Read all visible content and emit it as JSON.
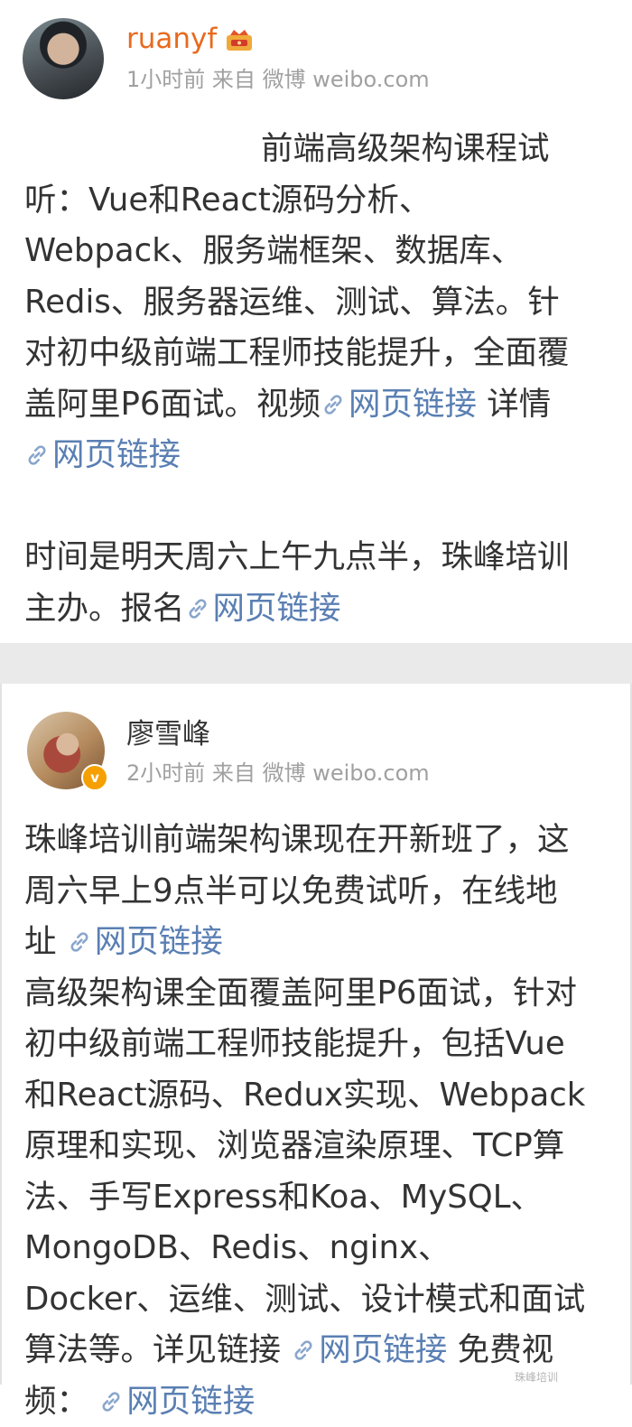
{
  "posts": [
    {
      "author": "ruanyf",
      "time": "1小时前",
      "source_prefix": "来自",
      "source": "微博 weibo.com",
      "badge_icon": "crown-member-icon",
      "body": {
        "l1": "前端高级架构课程试",
        "l2": "听：Vue和React源码分析、",
        "l3": "Webpack、服务端框架、数据库、",
        "l4": "Redis、服务器运维、测试、算法。针",
        "l5": "对初中级前端工程师技能提升，全面覆",
        "l6a": "盖阿里P6面试。视频",
        "link1": "网页链接",
        "l6b": " 详情",
        "link2": "网页链接",
        "l9": "时间是明天周六上午九点半，珠峰培训",
        "l10a": "主办。报名",
        "link3": "网页链接"
      }
    },
    {
      "author": "廖雪峰",
      "time": "2小时前",
      "source_prefix": "来自",
      "source": "微博 weibo.com",
      "verified_mark": "v",
      "body": {
        "l1": "珠峰培训前端架构课现在开新班了，这",
        "l2": "周六早上9点半可以免费试听，在线地",
        "l3a": "址 ",
        "link1": "网页链接",
        "l4": "高级架构课全面覆盖阿里P6面试，针对",
        "l5": "初中级前端工程师技能提升，包括Vue",
        "l6": "和React源码、Redux实现、Webpack",
        "l7": "原理和实现、浏览器渲染原理、TCP算",
        "l8": "法、手写Express和Koa、MySQL、",
        "l9": "MongoDB、Redis、nginx、",
        "l10": "Docker、运维、测试、设计模式和面试",
        "l11a": "算法等。详见链接 ",
        "link2": "网页链接",
        "l11b": " 免费视",
        "l12a": "频： ",
        "link3": "网页链接"
      }
    }
  ],
  "colors": {
    "vip_name": "#e86a1f",
    "link": "#5a7fb3",
    "meta": "#a0a0a0",
    "divider": "#eaeaea"
  },
  "icons": {
    "link": "link-chain-icon",
    "verified": "verified-badge-icon"
  },
  "watermark": "珠峰培训"
}
